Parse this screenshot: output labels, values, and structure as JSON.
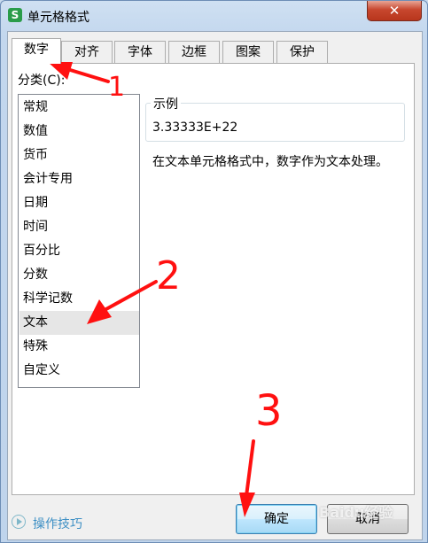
{
  "window": {
    "title": "单元格格式",
    "app_icon": "S",
    "close_glyph": "✕"
  },
  "tabs": [
    {
      "label": "数字",
      "active": true
    },
    {
      "label": "对齐"
    },
    {
      "label": "字体"
    },
    {
      "label": "边框"
    },
    {
      "label": "图案"
    },
    {
      "label": "保护"
    }
  ],
  "category": {
    "label": "分类(C):",
    "items": [
      "常规",
      "数值",
      "货币",
      "会计专用",
      "日期",
      "时间",
      "百分比",
      "分数",
      "科学记数",
      "文本",
      "特殊",
      "自定义"
    ],
    "selected": "文本"
  },
  "sample": {
    "legend": "示例",
    "value": "3.33333E+22"
  },
  "description": "在文本单元格格式中，数字作为文本处理。",
  "footer": {
    "hint": "操作技巧",
    "ok": "确定",
    "cancel": "取消"
  },
  "annotations": {
    "one": "1",
    "two": "2",
    "three": "3",
    "color": "#ff1010"
  },
  "watermark": "Baidu经验"
}
